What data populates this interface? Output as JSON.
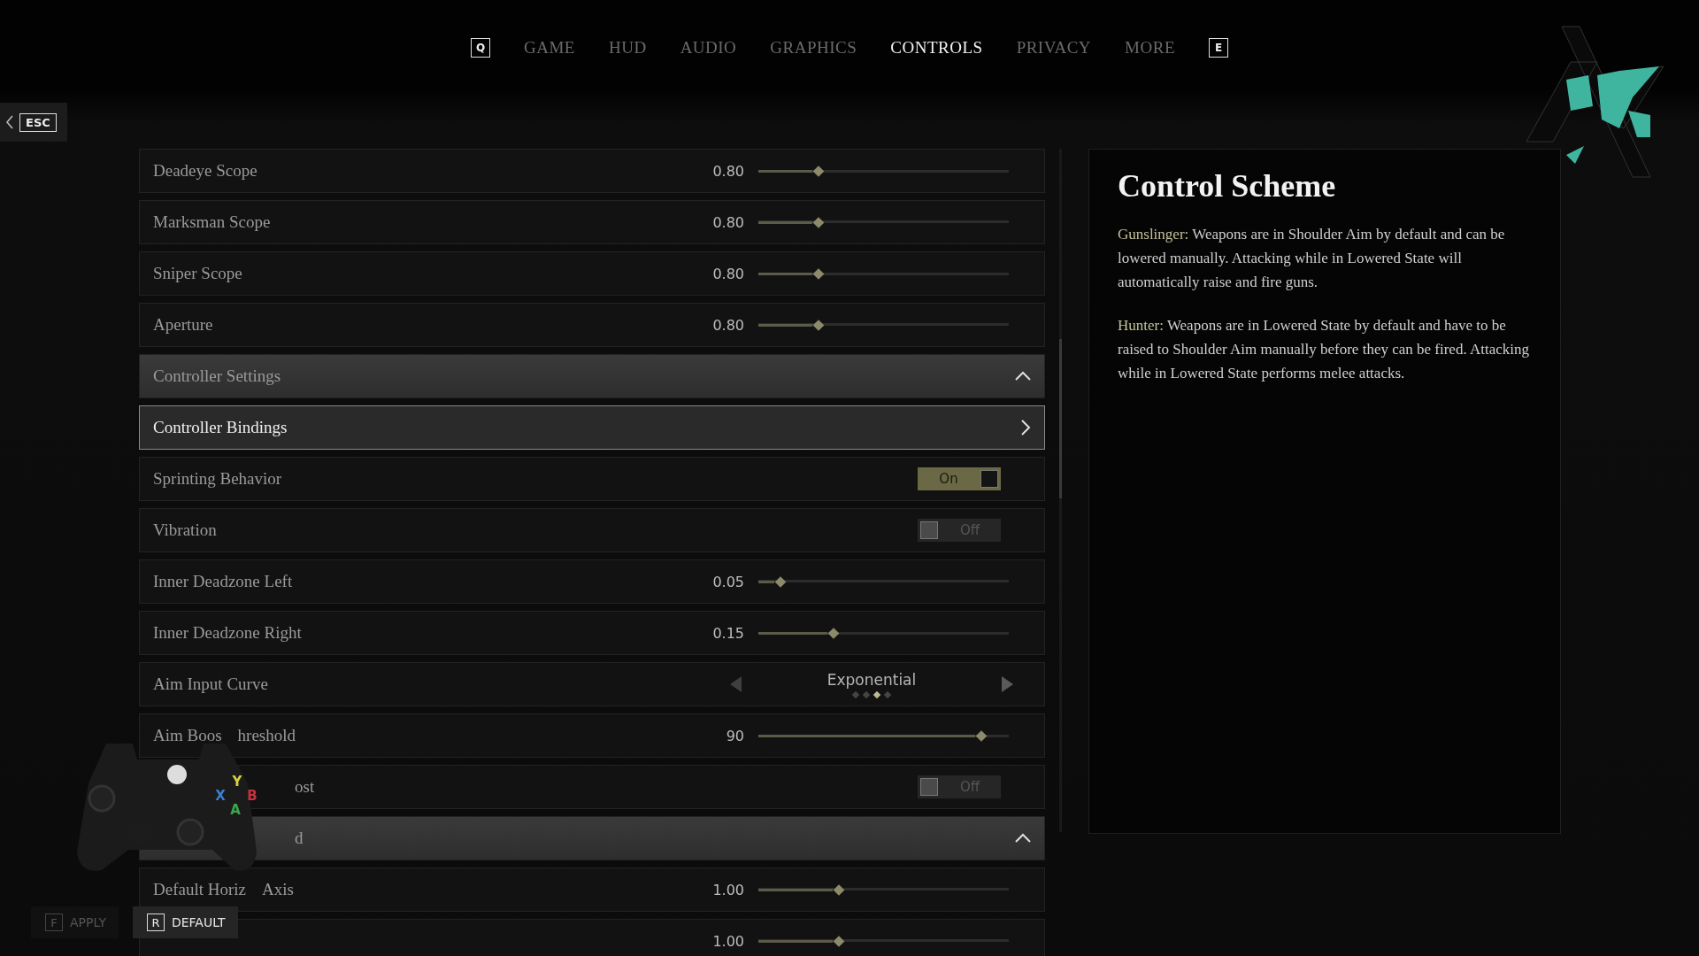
{
  "nav": {
    "prev_key": "Q",
    "next_key": "E",
    "tabs": [
      {
        "label": "GAME",
        "selected": false
      },
      {
        "label": "HUD",
        "selected": false
      },
      {
        "label": "AUDIO",
        "selected": false
      },
      {
        "label": "GRAPHICS",
        "selected": false
      },
      {
        "label": "CONTROLS",
        "selected": true
      },
      {
        "label": "PRIVACY",
        "selected": false
      },
      {
        "label": "MORE",
        "selected": false
      }
    ]
  },
  "back": {
    "key": "ESC"
  },
  "settings": [
    {
      "kind": "slider",
      "label": "Deadeye Scope",
      "value": "0.80",
      "level": 0.24
    },
    {
      "kind": "slider",
      "label": "Marksman Scope",
      "value": "0.80",
      "level": 0.24
    },
    {
      "kind": "slider",
      "label": "Sniper Scope",
      "value": "0.80",
      "level": 0.24
    },
    {
      "kind": "slider",
      "label": "Aperture",
      "value": "0.80",
      "level": 0.24
    },
    {
      "kind": "section",
      "label": "Controller Settings",
      "expanded": true
    },
    {
      "kind": "link",
      "label": "Controller Bindings",
      "selected": true
    },
    {
      "kind": "toggle",
      "label": "Sprinting Behavior",
      "on": true,
      "state_label": "On"
    },
    {
      "kind": "toggle",
      "label": "Vibration",
      "on": false,
      "state_label": "Off"
    },
    {
      "kind": "slider",
      "label": "Inner Deadzone Left",
      "value": "0.05",
      "level": 0.09
    },
    {
      "kind": "slider",
      "label": "Inner Deadzone Right",
      "value": "0.15",
      "level": 0.3
    },
    {
      "kind": "selector",
      "label": "Aim Input Curve",
      "value": "Exponential",
      "dots": [
        {
          "selected": false
        },
        {
          "selected": false
        },
        {
          "selected": true
        },
        {
          "selected": false
        }
      ]
    },
    {
      "kind": "slider",
      "label_parts": [
        "Aim Boos",
        "hreshold"
      ],
      "value": "90",
      "level": 0.89
    },
    {
      "kind": "toggle",
      "label": "ost",
      "covered_start": true,
      "on": false,
      "state_label": "Off"
    },
    {
      "kind": "section",
      "label": "d",
      "covered_start": true,
      "expanded": true
    },
    {
      "kind": "slider",
      "label_parts": [
        "Default Horiz",
        "Axis"
      ],
      "value": "1.00",
      "level": 0.32
    },
    {
      "kind": "slider",
      "value": "1.00",
      "level": 0.32
    }
  ],
  "info": {
    "title": "Control Scheme",
    "paragraphs": [
      {
        "term": "Gunslinger:",
        "text": "Weapons are in Shoulder Aim by default and can be lowered manually. Attacking while in Lowered State will automatically raise and fire guns."
      },
      {
        "term": "Hunter:",
        "text": "Weapons are in Lowered State by default and have to be raised to Shoulder Aim manually before they can be fired. Attacking while in Lowered State performs melee attacks."
      }
    ]
  },
  "controller": {
    "buttons": [
      {
        "label": "Y",
        "color": "#d8d23a"
      },
      {
        "label": "X",
        "color": "#3a7fd0"
      },
      {
        "label": "B",
        "color": "#c8323c"
      },
      {
        "label": "A",
        "color": "#3aa84a"
      }
    ]
  },
  "actions": [
    {
      "key": "F",
      "label": "APPLY",
      "disabled": true
    },
    {
      "key": "R",
      "label": "DEFAULT",
      "disabled": false
    }
  ]
}
